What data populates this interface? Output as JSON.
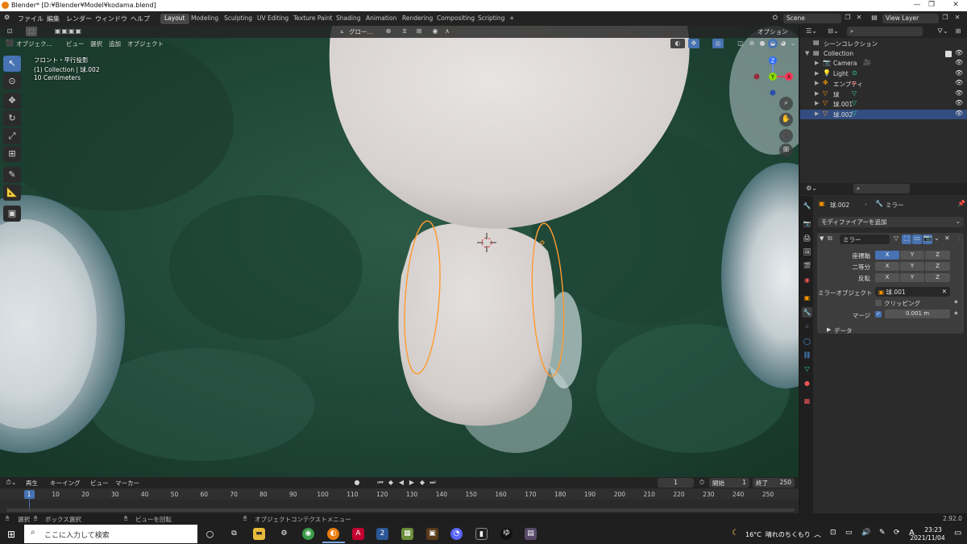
{
  "app": {
    "title": "Blender* [D:¥Blender¥Model¥kodama.blend]",
    "logo": "blender-icon"
  },
  "window_controls": [
    "—",
    "❐",
    "✕"
  ],
  "menu": [
    "ファイル",
    "編集",
    "レンダー",
    "ウィンドウ",
    "ヘルプ"
  ],
  "workspaces": [
    {
      "label": "Layout",
      "active": true
    },
    {
      "label": "Modeling",
      "active": false
    },
    {
      "label": "Sculpting",
      "active": false
    },
    {
      "label": "UV Editing",
      "active": false
    },
    {
      "label": "Texture Paint",
      "active": false
    },
    {
      "label": "Shading",
      "active": false
    },
    {
      "label": "Animation",
      "active": false
    },
    {
      "label": "Rendering",
      "active": false
    },
    {
      "label": "Compositing",
      "active": false
    },
    {
      "label": "Scripting",
      "active": false
    }
  ],
  "add_workspace": "+",
  "scene": {
    "label": "Scene",
    "view_layer": "View Layer"
  },
  "viewport_header": {
    "mode": "オブジェク...",
    "menus": [
      "ビュー",
      "選択",
      "追加",
      "オブジェクト"
    ],
    "transform_orientation": "グロー...",
    "options": "オプション"
  },
  "viewport_overlay": {
    "view_name": "フロント・平行投影",
    "collection_info": "(1) Collection | 球.002",
    "scale": "10 Centimeters"
  },
  "gizmo": {
    "z": "Z",
    "y": "Y",
    "x": "X"
  },
  "outliner": {
    "title": "シーンコレクション",
    "items": [
      {
        "label": "Collection",
        "level": 1,
        "icon": "collection-icon",
        "selected": false
      },
      {
        "label": "Camera",
        "level": 2,
        "icon": "camera-icon",
        "selected": false
      },
      {
        "label": "Light",
        "level": 2,
        "icon": "light-icon",
        "selected": false
      },
      {
        "label": "エンプティ",
        "level": 2,
        "icon": "empty-icon",
        "selected": false
      },
      {
        "label": "球",
        "level": 2,
        "icon": "mesh-icon",
        "selected": false
      },
      {
        "label": "球.001",
        "level": 2,
        "icon": "mesh-icon",
        "selected": false
      },
      {
        "label": "球.002",
        "level": 2,
        "icon": "mesh-icon",
        "selected": true
      }
    ]
  },
  "properties": {
    "breadcrumb_object": "球.002",
    "breadcrumb_modifier": "ミラー",
    "add_modifier": "モディファイアーを追加",
    "modifier_name": "ミラー",
    "rows": [
      {
        "label": "座標軸",
        "x": "X",
        "y": "Y",
        "z": "Z",
        "x_on": true
      },
      {
        "label": "二等分",
        "x": "X",
        "y": "Y",
        "z": "Z",
        "x_on": false
      },
      {
        "label": "反転",
        "x": "X",
        "y": "Y",
        "z": "Z",
        "x_on": false
      }
    ],
    "mirror_object_label": "ミラーオブジェクト",
    "mirror_object_value": "球.001",
    "clipping_label": "クリッピング",
    "clipping_checked": false,
    "merge_label": "マージ",
    "merge_checked": true,
    "merge_value": "0.001 m",
    "data_label": "データ"
  },
  "timeline": {
    "menus": [
      "再生",
      "キーイング",
      "ビュー",
      "マーカー"
    ],
    "current_frame": "1",
    "start_label": "開始",
    "start": "1",
    "end_label": "終了",
    "end": "250",
    "ticks": [
      "1",
      "10",
      "20",
      "30",
      "40",
      "50",
      "60",
      "70",
      "80",
      "90",
      "100",
      "110",
      "120",
      "130",
      "140",
      "150",
      "160",
      "170",
      "180",
      "190",
      "200",
      "210",
      "220",
      "230",
      "240",
      "250"
    ]
  },
  "statusbar": {
    "select": "選択",
    "box_select": "ボックス選択",
    "rotate_view": "ビューを回転",
    "context_menu": "オブジェクトコンテクストメニュー",
    "version": "2.92.0"
  },
  "taskbar": {
    "search_placeholder": "ここに入力して検索",
    "weather": "16°C  晴れのちくもり",
    "ime": "A",
    "time": "23:23",
    "date": "2021/11/04"
  },
  "colors": {
    "accent": "#4772b3",
    "selection_orange": "#ff9a2e",
    "panel": "#2b2b2b",
    "header": "#232323"
  }
}
